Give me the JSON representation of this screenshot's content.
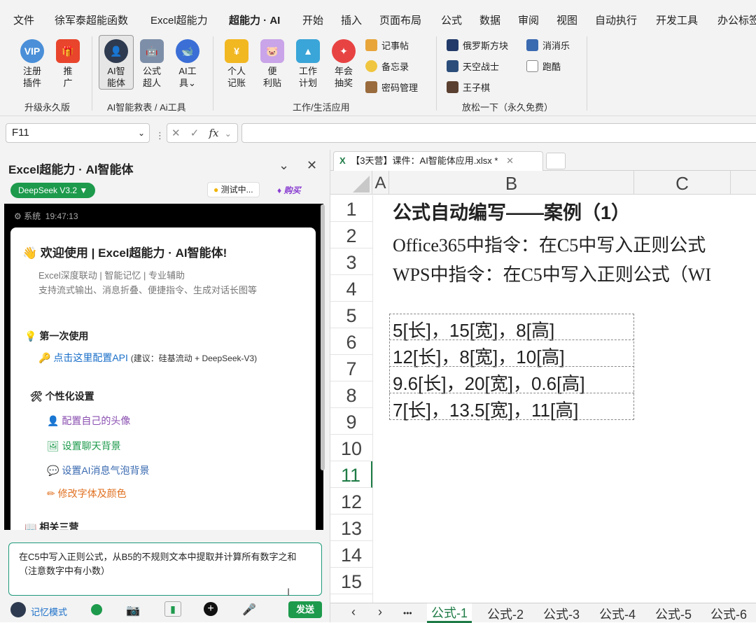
{
  "menu": [
    "文件",
    "徐军泰超能函数",
    "Excel超能力",
    "超能力 · AI",
    "开始",
    "插入",
    "页面布局",
    "公式",
    "数据",
    "审阅",
    "视图",
    "自动执行",
    "开发工具",
    "办公标签"
  ],
  "ribbon": {
    "b_register": "注册\n插件",
    "b_promo": "推\n广",
    "g1": "升级永久版",
    "b_ai": "AI智\n能体",
    "b_formula": "公式\n超人",
    "b_aitools": "AI工\n具⌄",
    "g2": "AI智能救表 / Ai工具",
    "b_acct": "个人\n记账",
    "b_note": "便\n利贴",
    "b_plan": "工作\n计划",
    "b_lottery": "年会\n抽奖",
    "s_notepad": "记事帖",
    "s_memo": "备忘录",
    "s_pwd": "密码管理",
    "g3": "工作/生活应用",
    "s_tetris": "俄罗斯方块",
    "s_skywar": "天空战士",
    "s_chess": "王子棋",
    "s_elim": "消消乐",
    "s_run": "跑酷",
    "g4": "放松一下（永久免费）"
  },
  "formula": {
    "cellref": "F11",
    "fx": "fx"
  },
  "panel": {
    "title": "Excel超能力 · AI智能体",
    "model": "DeepSeek V3.2 ▼",
    "test": "测试中...",
    "buy": "购买",
    "sys": "系统",
    "time": "19:47:13",
    "welcome": "欢迎使用 | Excel超能力 · AI智能体!",
    "sub1": "Excel深度联动 | 智能记忆 | 专业辅助",
    "sub2": "支持流式输出、消息折叠、便捷指令、生成对话长图等",
    "first": "第一次使用",
    "cfg": "点击这里配置API",
    "cfg_hint": "(建议：硅基流动 + DeepSeek-V3)",
    "personal": "个性化设置",
    "avatar": "配置自己的头像",
    "bg": "设置聊天背景",
    "bubble": "设置AI消息气泡背景",
    "font": "修改字体及颜色",
    "partial": "相关三营",
    "input": "在C5中写入正则公式，从B5的不规则文本中提取并计算所有数字之和（注意数字中有小数）",
    "mem": "记忆模式",
    "send": "发送"
  },
  "file_tab": "【3天营】课件：AI智能体应用.xlsx *",
  "columns": [
    "A",
    "B",
    "C"
  ],
  "rows": [
    "1",
    "2",
    "3",
    "4",
    "5",
    "6",
    "7",
    "8",
    "9",
    "10",
    "11",
    "12",
    "13",
    "14",
    "15"
  ],
  "cells": {
    "r1": "公式自动编写——案例（1）",
    "r2": "Office365中指令：在C5中写入正则公式",
    "r3": "WPS中指令：在C5中写入正则公式（WI",
    "r5": "5[长]，15[宽]，8[高]",
    "r6": "12[长]，8[宽]，10[高]",
    "r7": "9.6[长]，20[宽]，0.6[高]",
    "r8": "7[长]，13.5[宽]，11[高]"
  },
  "sheet_tabs": [
    "公式-1",
    "公式-2",
    "公式-3",
    "公式-4",
    "公式-5",
    "公式-6"
  ],
  "nav": {
    "prev": "‹",
    "next": "›",
    "more": "•••"
  }
}
